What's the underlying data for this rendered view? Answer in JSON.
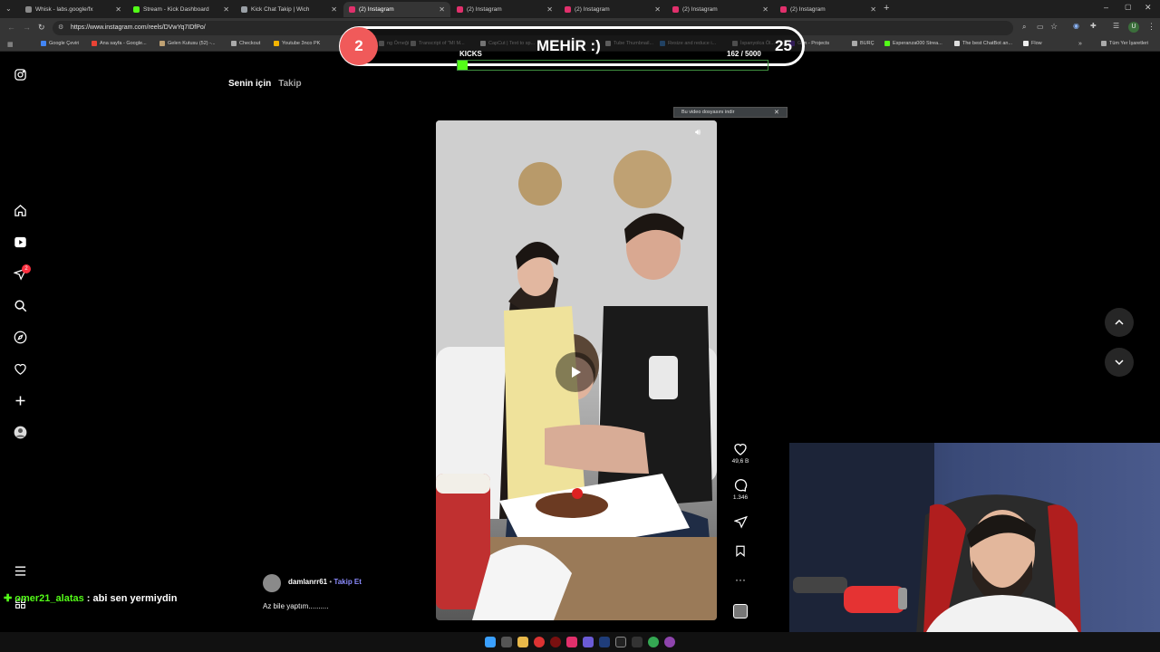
{
  "browser": {
    "tabs": [
      {
        "title": "Whisk - labs.google/fx",
        "color": "#8a8a8a"
      },
      {
        "title": "Stream - Kick Dashboard",
        "color": "#53fc18"
      },
      {
        "title": "Kick Chat Takip | Wich",
        "color": "#9aa0a6"
      },
      {
        "title": "(2) Instagram",
        "color": "#e1306c",
        "active": true
      },
      {
        "title": "(2) Instagram",
        "color": "#e1306c"
      },
      {
        "title": "(2) Instagram",
        "color": "#e1306c"
      },
      {
        "title": "(2) Instagram",
        "color": "#e1306c"
      },
      {
        "title": "(2) Instagram",
        "color": "#e1306c"
      }
    ],
    "url": "https://www.instagram.com/reels/DVwYq7IDfPo/",
    "bookmarks": [
      "Google Çeviri",
      "Ana sayfa - Google...",
      "Gelen Kutusu (52) -...",
      "Checkout",
      "Youtube 3nco PK",
      "ng Örneği",
      "Transcript of \"MI M...",
      "CapCut | Text to sp...",
      "Tube Thumbnail...",
      "Resize and reduce i...",
      "İspanyolca Öl...",
      "Gen - Projects",
      "BURÇ",
      "Esperanza000 Strea...",
      "The best ChatBot an...",
      "Flow"
    ],
    "all_bookmarks": "Tüm Yer İşaretleri"
  },
  "instagram": {
    "tabs": [
      "Senin için",
      "Takip"
    ],
    "notification_count": "2",
    "post": {
      "username": "damlanrr61",
      "follow_label": "Takip Et",
      "caption": "Az bile yaptım..........",
      "likes": "49,6 B",
      "comments": "1.346"
    },
    "download_banner": "Bu video dosyasını indir"
  },
  "stream_overlay": {
    "left_count": "2",
    "name": "MEHİR :)",
    "right_count": "25",
    "kicks_label": "KICKS",
    "kicks_progress": "162 / 5000",
    "kicks_fraction": 0.0324,
    "chat_user": "omer21_alatas",
    "chat_message": ": abi sen yermiydin"
  },
  "colors": {
    "kick_green": "#53fc18",
    "follow_blue": "#8c8cff"
  }
}
